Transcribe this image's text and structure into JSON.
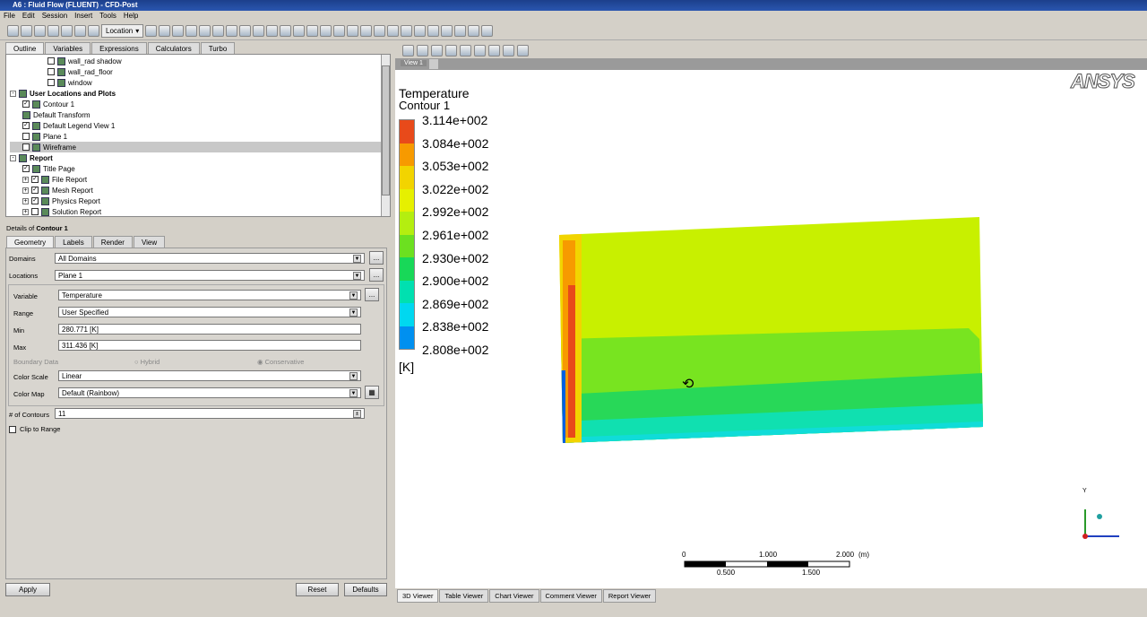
{
  "window": {
    "title": "A6 : Fluid Flow (FLUENT) - CFD-Post"
  },
  "menu": [
    "File",
    "Edit",
    "Session",
    "Insert",
    "Tools",
    "Help"
  ],
  "toolbar": {
    "location_label": "Location"
  },
  "left_tabs": [
    "Outline",
    "Variables",
    "Expressions",
    "Calculators",
    "Turbo"
  ],
  "tree": [
    {
      "label": "wall_rad shadow",
      "indent": 3,
      "checked": false
    },
    {
      "label": "wall_rad_floor",
      "indent": 3,
      "checked": false
    },
    {
      "label": "window",
      "indent": 3,
      "checked": false
    },
    {
      "label": "User Locations and Plots",
      "indent": 0,
      "bold": true,
      "expander": "-"
    },
    {
      "label": "Contour 1",
      "indent": 1,
      "checked": true
    },
    {
      "label": "Default Transform",
      "indent": 1
    },
    {
      "label": "Default Legend View 1",
      "indent": 1,
      "checked": true
    },
    {
      "label": "Plane 1",
      "indent": 1,
      "checked": false
    },
    {
      "label": "Wireframe",
      "indent": 1,
      "checked": false,
      "selected": true
    },
    {
      "label": "Report",
      "indent": 0,
      "bold": true,
      "expander": "-"
    },
    {
      "label": "Title Page",
      "indent": 1,
      "checked": true
    },
    {
      "label": "File Report",
      "indent": 1,
      "checked": true,
      "expander": "+"
    },
    {
      "label": "Mesh Report",
      "indent": 1,
      "checked": true,
      "expander": "+"
    },
    {
      "label": "Physics Report",
      "indent": 1,
      "checked": true,
      "expander": "+"
    },
    {
      "label": "Solution Report",
      "indent": 1,
      "checked": false,
      "expander": "+"
    }
  ],
  "details": {
    "prefix": "Details of",
    "object": "Contour 1",
    "tabs": [
      "Geometry",
      "Labels",
      "Render",
      "View"
    ],
    "domains_label": "Domains",
    "domains": "All Domains",
    "locations_label": "Locations",
    "locations": "Plane 1",
    "variable_label": "Variable",
    "variable": "Temperature",
    "range_label": "Range",
    "range": "User Specified",
    "min_label": "Min",
    "min": "280.771 [K]",
    "max_label": "Max",
    "max": "311.436 [K]",
    "boundary_label": "Boundary Data",
    "hybrid": "Hybrid",
    "conservative": "Conservative",
    "color_scale_label": "Color Scale",
    "color_scale": "Linear",
    "color_map_label": "Color Map",
    "color_map": "Default (Rainbow)",
    "contours_label": "# of Contours",
    "contours": "11",
    "clip_label": "Clip to Range",
    "more": "..."
  },
  "buttons": {
    "apply": "Apply",
    "reset": "Reset",
    "defaults": "Defaults"
  },
  "viewer": {
    "tab": "View 1",
    "logo": "ANSYS",
    "legend_title": "Temperature",
    "legend_sub": "Contour 1",
    "unit": "[K]",
    "legend_values": [
      "3.114e+002",
      "3.084e+002",
      "3.053e+002",
      "3.022e+002",
      "2.992e+002",
      "2.961e+002",
      "2.930e+002",
      "2.900e+002",
      "2.869e+002",
      "2.838e+002",
      "2.808e+002"
    ],
    "legend_colors": [
      "#e84a1a",
      "#f79a00",
      "#f2d400",
      "#e6f000",
      "#b4ee10",
      "#6ce020",
      "#18d858",
      "#00e0b0",
      "#00d8f0",
      "#0090f0"
    ],
    "scale_top": [
      "0",
      "1.000",
      "2.000",
      "(m)"
    ],
    "scale_bottom": [
      "0.500",
      "1.500"
    ],
    "axis_y": "Y"
  },
  "bottom_tabs": [
    "3D Viewer",
    "Table Viewer",
    "Chart Viewer",
    "Comment Viewer",
    "Report Viewer"
  ]
}
